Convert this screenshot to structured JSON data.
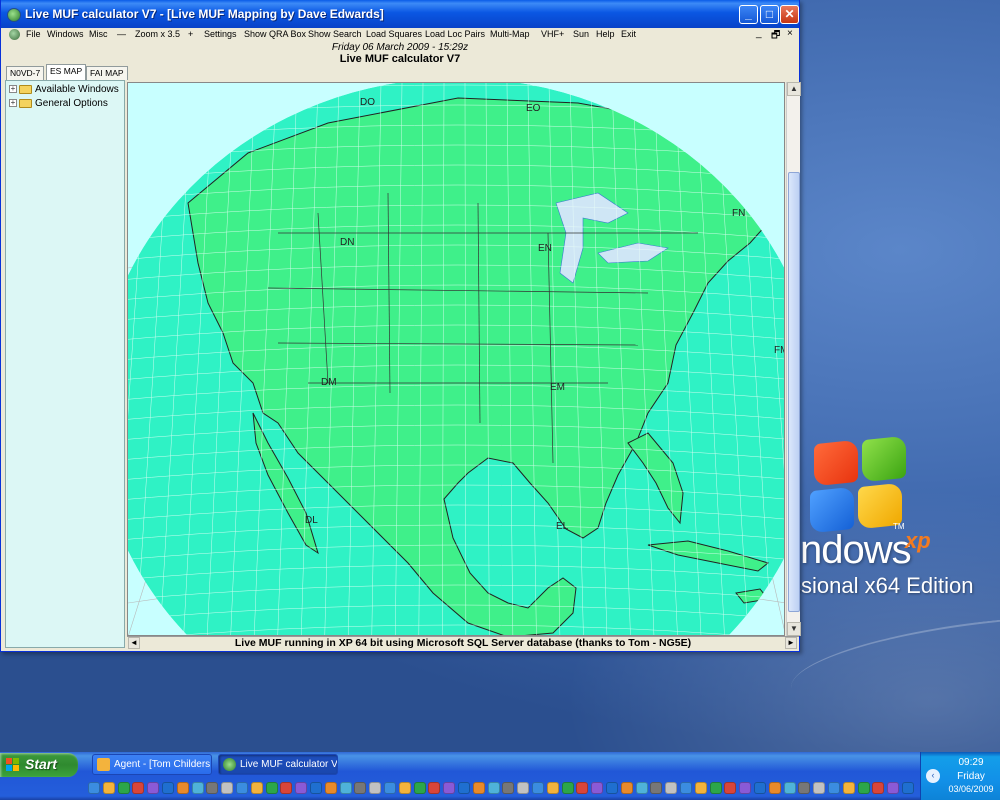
{
  "window": {
    "title": "Live MUF calculator V7 - [Live MUF Mapping by Dave Edwards]",
    "controls": {
      "minimize": "_",
      "maximize": "□",
      "close": "✕"
    },
    "menu": [
      {
        "id": "file",
        "label": "File"
      },
      {
        "id": "windows",
        "label": "Windows"
      },
      {
        "id": "misc",
        "label": "Misc"
      },
      {
        "id": "zoom-out",
        "label": "—"
      },
      {
        "id": "zoom",
        "label": "Zoom x 3.5"
      },
      {
        "id": "zoom-in",
        "label": "+"
      },
      {
        "id": "settings",
        "label": "Settings"
      },
      {
        "id": "show-qra-box",
        "label": "Show QRA Box"
      },
      {
        "id": "show-search",
        "label": "Show Search"
      },
      {
        "id": "load-squares",
        "label": "Load Squares"
      },
      {
        "id": "load-loc-pairs",
        "label": "Load Loc Pairs"
      },
      {
        "id": "multi-map",
        "label": "Multi-Map"
      },
      {
        "id": "vhf-plus",
        "label": "VHF+"
      },
      {
        "id": "sun",
        "label": "Sun"
      },
      {
        "id": "help",
        "label": "Help"
      },
      {
        "id": "exit",
        "label": "Exit"
      }
    ],
    "mdi_controls": {
      "minimize": "_",
      "restore": "🗗",
      "close": "×"
    },
    "date_line": "Friday 06 March 2009 - 15:29z",
    "app_line": "Live MUF calculator V7",
    "tabs": [
      {
        "label": "N0VD-7",
        "active": false
      },
      {
        "label": "ES MAP",
        "active": true
      },
      {
        "label": "FAI MAP",
        "active": false
      }
    ],
    "tree": [
      {
        "label": "Available Windows",
        "expander": "+"
      },
      {
        "label": "General Options",
        "expander": "+"
      }
    ],
    "map_grid_labels": [
      "DO",
      "EO",
      "DN",
      "EN",
      "FN",
      "FM",
      "DM",
      "EM",
      "DL",
      "EL"
    ],
    "status_text": "Live MUF running in XP 64 bit using Microsoft SQL Server database (thanks to Tom - NG5E)",
    "scroll_arrows": {
      "up": "▲",
      "down": "▼",
      "left": "◄",
      "right": "►"
    }
  },
  "desktop": {
    "brand_word": "ndows",
    "brand_xp": "xp",
    "brand_tm": "TM",
    "edition_text": "ssional x64 Edition"
  },
  "taskbar": {
    "start_label": "Start",
    "tasks": [
      {
        "label": "Agent - [Tom Childers...",
        "active": false
      },
      {
        "label": "Live MUF calculator V...",
        "active": true
      }
    ],
    "tray_chevron": "‹",
    "clock_time": "09:29",
    "clock_day": "Friday",
    "clock_date": "03/06/2009"
  },
  "colors": {
    "land": "#3ff08a",
    "ocean": "#c8ffff",
    "globe_sea": "#2ff2c5",
    "titlebar": "#0a57e3",
    "taskbar": "#245edb",
    "start": "#2f8a2f"
  }
}
